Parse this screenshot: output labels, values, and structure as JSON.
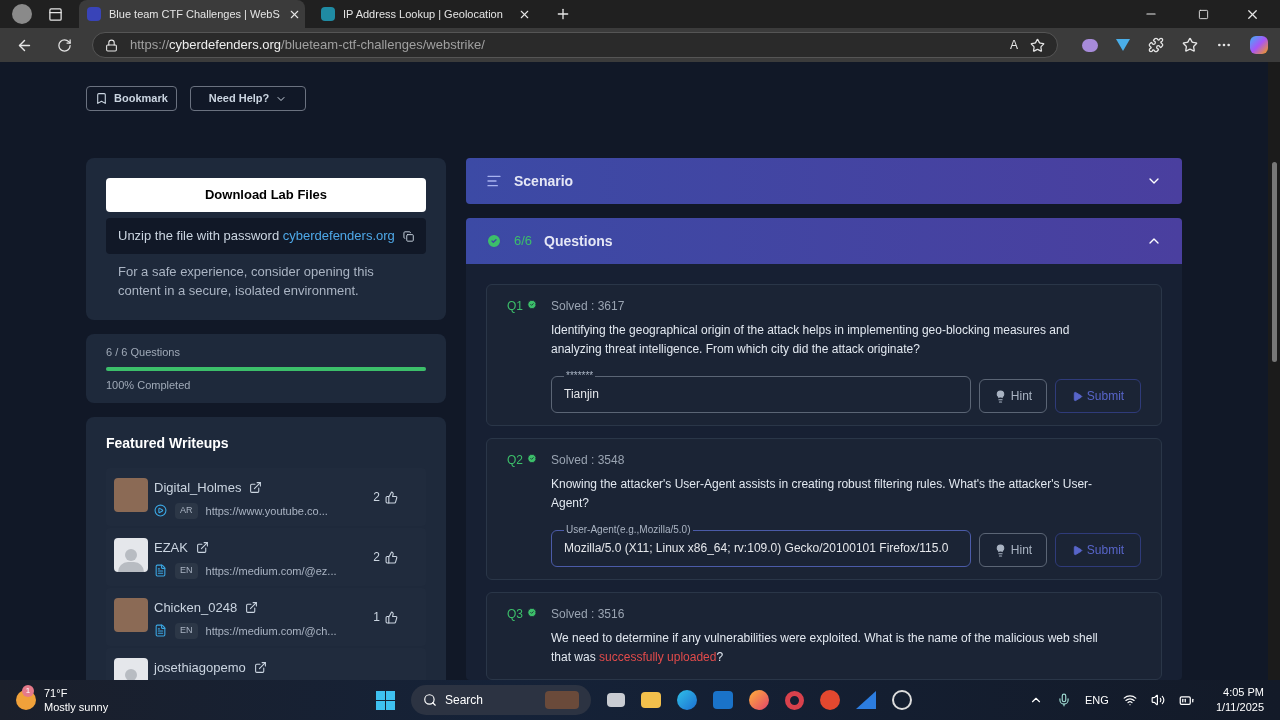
{
  "browser": {
    "tabs": [
      {
        "title": "Blue team CTF Challenges | WebS",
        "selected": true
      },
      {
        "title": "IP Address Lookup | Geolocation",
        "selected": false
      }
    ],
    "read_aloud_glyph": "A",
    "url": {
      "scheme": "https://",
      "domain": "cyberdefenders.org",
      "path": "/blueteam-ctf-challenges/webstrike/"
    }
  },
  "actions": [
    {
      "label": "Bookmark",
      "kind": "bookmark"
    },
    {
      "label": "Need Help?",
      "kind": "dropdown"
    }
  ],
  "lab": {
    "download": "Download Lab Files",
    "password_text": "Unzip the file with password",
    "password": "cyberdefenders.org",
    "note": "For a safe experience, consider opening this content in a secure, isolated environment."
  },
  "progress": {
    "count": "6 / 6 Questions",
    "level": 1,
    "completed": "100% Completed"
  },
  "writeups": {
    "title": "Featured Writeups",
    "items": [
      {
        "name": "Digital_Holmes",
        "photo": true,
        "kind": "video",
        "lang": "AR",
        "url": "https://www.youtube.co...",
        "likes": "2"
      },
      {
        "name": "EZAK",
        "photo": false,
        "kind": "article",
        "lang": "EN",
        "url": "https://medium.com/@ez...",
        "likes": "2"
      },
      {
        "name": "Chicken_0248",
        "photo": true,
        "kind": "article",
        "lang": "EN",
        "url": "https://medium.com/@ch...",
        "likes": "1"
      },
      {
        "name": "josethiagopemo",
        "photo": false
      }
    ]
  },
  "scenario": {
    "title": "Scenario",
    "expanded": false
  },
  "questions_panel": {
    "count": "6/6",
    "title": "Questions",
    "expanded": true,
    "complete": true
  },
  "questions": [
    {
      "number": "Q1",
      "solved": true,
      "solved_count": "Solved : 3617",
      "text": [
        {
          "kind": "plain",
          "text": "Identifying the geographical origin of the attack helps in implementing geo-blocking measures and analyzing threat intelligence. From which city did the attack originate?"
        }
      ],
      "field_label": "*******",
      "value": "Tianjin",
      "hint": "Hint",
      "submit": "Submit"
    },
    {
      "number": "Q2",
      "solved": true,
      "solved_count": "Solved : 3548",
      "text": [
        {
          "kind": "plain",
          "text": "Knowing the attacker's User-Agent assists in creating robust filtering rules. What's the attacker's User-Agent?"
        }
      ],
      "field_label": "User-Agent(e.g.,Mozilla/5.0)",
      "value": "Mozilla/5.0 (X11; Linux x86_64; rv:109.0) Gecko/20100101 Firefox/115.0",
      "hint": "Hint",
      "submit": "Submit"
    },
    {
      "number": "Q3",
      "solved": true,
      "solved_count": "Solved : 3516",
      "text": [
        {
          "kind": "plain",
          "text": "We need to determine if any vulnerabilities were exploited. What is the name of the malicious web shell that was "
        },
        {
          "kind": "highlight",
          "text": "successfully uploaded"
        },
        {
          "kind": "plain",
          "text": "?"
        }
      ]
    }
  ],
  "taskbar": {
    "weather": {
      "badge": "1",
      "temp": "71°F",
      "condition": "Mostly sunny"
    },
    "search": "Search",
    "lang": "ENG",
    "time": "4:05 PM",
    "date": "1/11/2025"
  }
}
